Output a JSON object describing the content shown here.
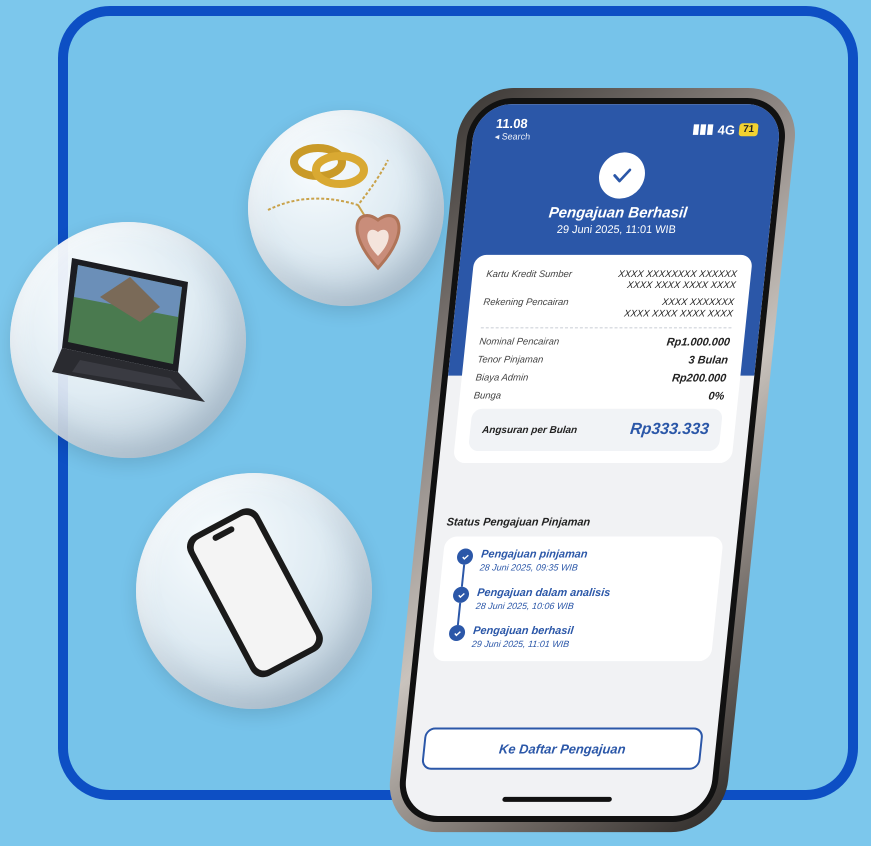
{
  "statusbar": {
    "time": "11.08",
    "back_label": "◂ Search",
    "signal": "4G",
    "battery": "71"
  },
  "header": {
    "title": "Pengajuan Berhasil",
    "date": "29 Juni 2025, 11:01 WIB"
  },
  "details": {
    "kartu_label": "Kartu Kredit Sumber",
    "kartu_value_1": "XXXX XXXXXXXX XXXXXX",
    "kartu_value_2": "XXXX XXXX XXXX XXXX",
    "rekening_label": "Rekening Pencairan",
    "rekening_value_1": "XXXX XXXXXXX",
    "rekening_value_2": "XXXX XXXX XXXX XXXX",
    "nominal_label": "Nominal Pencairan",
    "nominal_value": "Rp1.000.000",
    "tenor_label": "Tenor Pinjaman",
    "tenor_value": "3 Bulan",
    "admin_label": "Biaya Admin",
    "admin_value": "Rp200.000",
    "bunga_label": "Bunga",
    "bunga_value": "0%",
    "installment_label": "Angsuran per Bulan",
    "installment_value": "Rp333.333"
  },
  "status": {
    "heading": "Status Pengajuan Pinjaman",
    "items": [
      {
        "title": "Pengajuan pinjaman",
        "date": "28 Juni 2025, 09:35 WIB"
      },
      {
        "title": "Pengajuan dalam analisis",
        "date": "28 Juni 2025, 10:06 WIB"
      },
      {
        "title": "Pengajuan berhasil",
        "date": "29 Juni 2025, 11:01 WIB"
      }
    ]
  },
  "cta": {
    "label": "Ke Daftar Pengajuan"
  },
  "colors": {
    "primary": "#2b57a8",
    "frame": "#0d4fc4",
    "background": "#7cc7ec"
  }
}
